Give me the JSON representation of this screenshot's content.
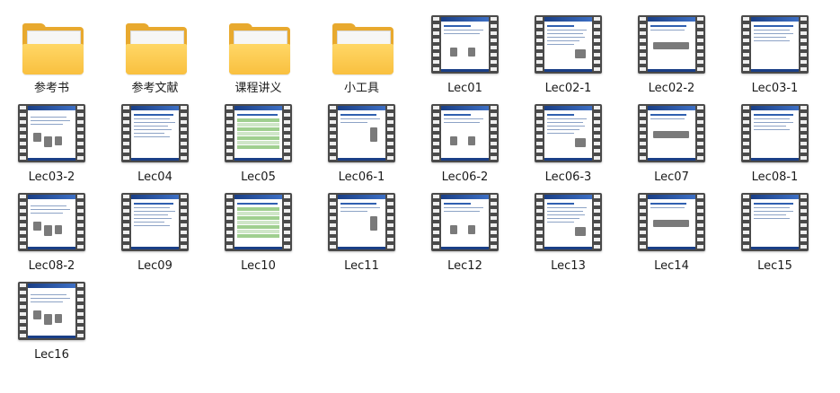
{
  "items": [
    {
      "kind": "folder",
      "label": "参考书",
      "icon": "folder-icon"
    },
    {
      "kind": "folder",
      "label": "参考文献",
      "icon": "folder-icon"
    },
    {
      "kind": "folder",
      "label": "课程讲义",
      "icon": "folder-icon"
    },
    {
      "kind": "folder",
      "label": "小工具",
      "icon": "folder-icon"
    },
    {
      "kind": "video",
      "label": "Lec01",
      "icon": "video-file-icon"
    },
    {
      "kind": "video",
      "label": "Lec02-1",
      "icon": "video-file-icon"
    },
    {
      "kind": "video",
      "label": "Lec02-2",
      "icon": "video-file-icon"
    },
    {
      "kind": "video",
      "label": "Lec03-1",
      "icon": "video-file-icon"
    },
    {
      "kind": "video",
      "label": "Lec03-2",
      "icon": "video-file-icon"
    },
    {
      "kind": "video",
      "label": "Lec04",
      "icon": "video-file-icon"
    },
    {
      "kind": "video",
      "label": "Lec05",
      "icon": "video-file-icon"
    },
    {
      "kind": "video",
      "label": "Lec06-1",
      "icon": "video-file-icon"
    },
    {
      "kind": "video",
      "label": "Lec06-2",
      "icon": "video-file-icon"
    },
    {
      "kind": "video",
      "label": "Lec06-3",
      "icon": "video-file-icon"
    },
    {
      "kind": "video",
      "label": "Lec07",
      "icon": "video-file-icon"
    },
    {
      "kind": "video",
      "label": "Lec08-1",
      "icon": "video-file-icon"
    },
    {
      "kind": "video",
      "label": "Lec08-2",
      "icon": "video-file-icon"
    },
    {
      "kind": "video",
      "label": "Lec09",
      "icon": "video-file-icon"
    },
    {
      "kind": "video",
      "label": "Lec10",
      "icon": "video-file-icon"
    },
    {
      "kind": "video",
      "label": "Lec11",
      "icon": "video-file-icon"
    },
    {
      "kind": "video",
      "label": "Lec12",
      "icon": "video-file-icon"
    },
    {
      "kind": "video",
      "label": "Lec13",
      "icon": "video-file-icon"
    },
    {
      "kind": "video",
      "label": "Lec14",
      "icon": "video-file-icon"
    },
    {
      "kind": "video",
      "label": "Lec15",
      "icon": "video-file-icon"
    },
    {
      "kind": "video",
      "label": "Lec16",
      "icon": "video-file-icon"
    }
  ],
  "colors": {
    "folder_front": "#f9c03f",
    "folder_back": "#e8a92e",
    "film_frame": "#4a4a4a",
    "slide_header": "#1a3f86"
  }
}
